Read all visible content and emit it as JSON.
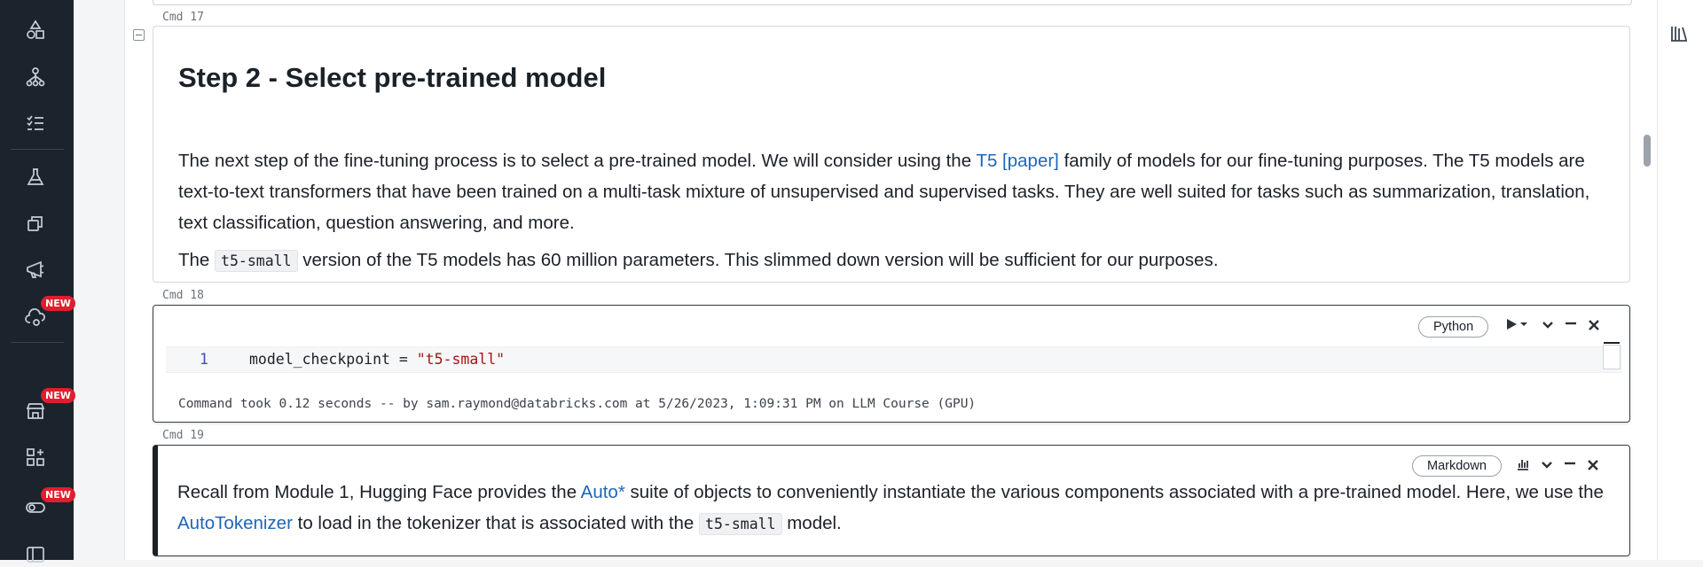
{
  "nav": {
    "badge_new": "NEW",
    "icons": [
      "shapes-icon",
      "hierarchy-icon",
      "checklist-icon",
      "flask-icon",
      "layers-icon",
      "megaphone-icon",
      "cloud-refresh-icon",
      "store-icon",
      "add-apps-icon",
      "toggle-icon",
      "sidebar-panel-icon"
    ]
  },
  "notebook": {
    "cmd17": {
      "label": "Cmd 17",
      "heading": "Step 2 - Select pre-trained model",
      "p1_a": "The next step of the fine-tuning process is to select a pre-trained model. We will consider using the ",
      "p1_link": "T5 [paper]",
      "p1_b": " family of models for our fine-tuning purposes. The T5 models are text-to-text transformers that have been trained on a multi-task mixture of unsupervised and supervised tasks. They are well suited for tasks such as summarization, translation, text classification, question answering, and more.",
      "p2_a": "The ",
      "p2_code": "t5-small",
      "p2_b": " version of the T5 models has 60 million parameters. This slimmed down version will be sufficient for our purposes."
    },
    "cmd18": {
      "label": "Cmd 18",
      "language": "Python",
      "line_number": "1",
      "code_var": "model_checkpoint = ",
      "code_str": "\"t5-small\"",
      "result": "Command took 0.12 seconds -- by sam.raymond@databricks.com at 5/26/2023, 1:09:31 PM on LLM Course (GPU)"
    },
    "cmd19": {
      "label": "Cmd 19",
      "language": "Markdown",
      "text_a": "Recall from Module 1, Hugging Face provides the ",
      "link1": "Auto*",
      "text_b": " suite of objects to conveniently instantiate the various components associated with a pre-trained model. Here, we use the ",
      "link2": "AutoTokenizer",
      "text_c": " to load in the tokenizer that is associated with the ",
      "code": "t5-small",
      "text_d": " model."
    }
  },
  "colors": {
    "rail": "#1b232c",
    "link": "#1d66b8",
    "badge": "#e01e2e",
    "string": "#a31515"
  }
}
